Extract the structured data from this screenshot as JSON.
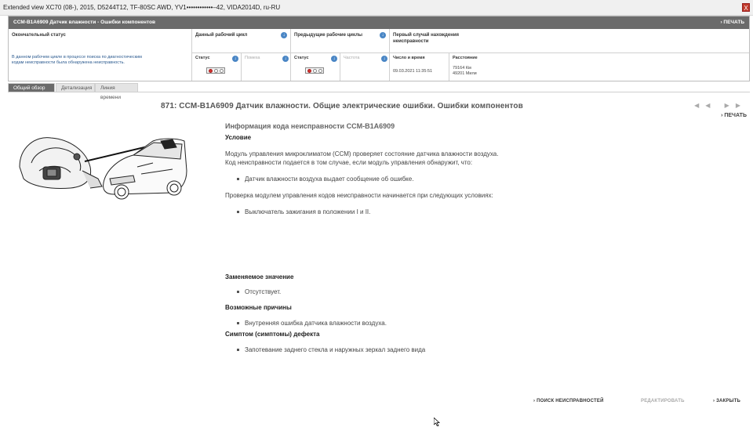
{
  "window": {
    "title": "Extended view   XC70 (08-), 2015, D5244T12, TF-80SC AWD, YV1••••••••••••–42, VIDA2014D, ru-RU",
    "close_label": "X"
  },
  "header": {
    "title": "CCM-B1A6909 Датчик влажности - Ошибки компонентов",
    "print_label": "› ПЕЧАТЬ"
  },
  "status_table": {
    "final_status_label": "Окончательный статус",
    "final_status_text": "В данном рабочем цикле в процессе поиска по диагностическим кодам неисправности была обнаружена неисправность.",
    "current_cycle_label": "Данный рабочий цикл",
    "previous_cycles_label": "Предыдущие рабочие циклы",
    "first_occurrence_label": "Первый случай нахождения неисправности",
    "status_label": "Статус",
    "interference_label": "Помеха",
    "frequency_label": "Частота",
    "datetime_label": "Число и время",
    "distance_label": "Расстояние",
    "datetime_value": "09.03.2021 11:35:51",
    "distance_km": "79164 Км",
    "distance_miles": "49201 Мили",
    "info_icon": "↓"
  },
  "tabs": [
    {
      "label": "Общий обзор",
      "active": true
    },
    {
      "label": "Детализация",
      "active": false
    },
    {
      "label": "Линия времени",
      "active": false
    }
  ],
  "document": {
    "title": "871: CCM-B1A6909 Датчик влажности. Общие электрические ошибки. Ошибки компонентов",
    "print_label": "› ПЕЧАТЬ",
    "nav_arrows": "◀◀ ▶▶",
    "info_heading": "Информация кода неисправности CCM-B1A6909",
    "condition_heading": "Условие",
    "condition_p1": "Модуль управления микроклиматом (CCM) проверяет состояние датчика влажности воздуха.",
    "condition_p2": "Код неисправности подается в том случае, если модуль управления обнаружит, что:",
    "condition_bullet": "Датчик влажности воздуха выдает сообщение об ошибке.",
    "check_p": "Проверка модулем управления кодов неисправности начинается при следующих условиях:",
    "check_bullet": "Выключатель зажигания в положении I и II.",
    "substitute_heading": "Заменяемое значение",
    "substitute_bullet": "Отсутствует.",
    "causes_heading": "Возможные причины",
    "causes_bullet": "Внутренняя ошибка датчика влажности воздуха.",
    "symptoms_heading": "Симптом (симптомы) дефекта",
    "symptoms_bullet": "Запотевание заднего стекла и наружных зеркал заднего вида"
  },
  "footer": {
    "search_label": "› ПОИСК НЕИСПРАВНОСТЕЙ",
    "edit_label": "РЕДАКТИРОВАТЬ",
    "close_label": "› ЗАКРЫТЬ"
  },
  "colors": {
    "header_bg": "#6b6b6b",
    "led_active": "#d0312d",
    "info_icon": "#4a86c5"
  }
}
